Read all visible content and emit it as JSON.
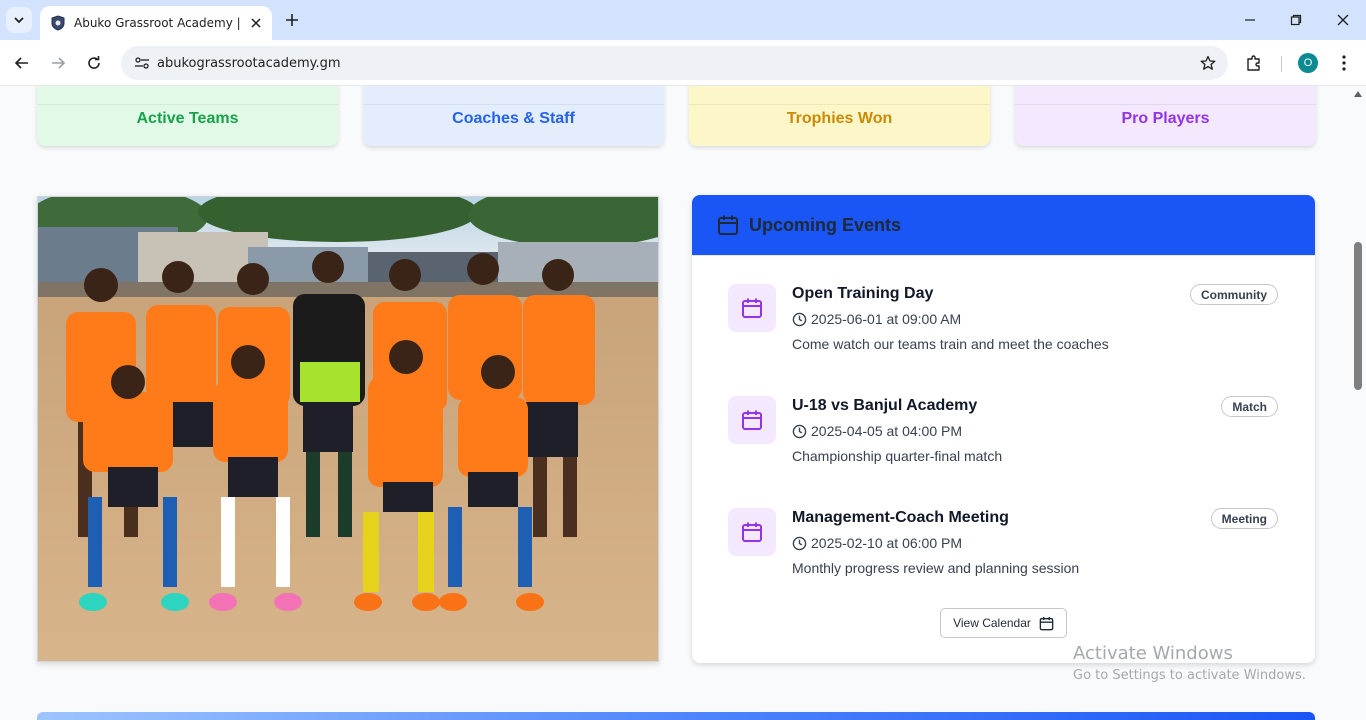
{
  "browser": {
    "tab_title": "Abuko Grassroot Academy | Football",
    "url": "abukograssrootacademy.gm",
    "profile_initial": "O",
    "icons": [
      "tab-list-icon",
      "shield-favicon-icon",
      "close-icon",
      "plus-icon",
      "minimize-icon",
      "restore-icon",
      "close-window-icon",
      "back-arrow-icon",
      "forward-arrow-icon",
      "reload-icon",
      "site-settings-icon",
      "bookmark-star-icon",
      "extensions-icon",
      "kebab-menu-icon"
    ]
  },
  "stats": [
    {
      "label": "Active Teams",
      "color": "#16a34a",
      "bg": "#e3f9e8"
    },
    {
      "label": "Coaches & Staff",
      "color": "#2563eb",
      "bg": "#e3edfb"
    },
    {
      "label": "Trophies Won",
      "color": "#ca8a04",
      "bg": "#fdf6c9"
    },
    {
      "label": "Pro Players",
      "color": "#9333ea",
      "bg": "#f3e8fd"
    }
  ],
  "events_panel": {
    "title": "Upcoming Events",
    "header_color": "#1a56f5",
    "items": [
      {
        "title": "Open Training Day",
        "time": "2025-06-01 at 09:00 AM",
        "description": "Come watch our teams train and meet the coaches",
        "badge": "Community"
      },
      {
        "title": "U-18 vs Banjul Academy",
        "time": "2025-04-05 at 04:00 PM",
        "description": "Championship quarter-final match",
        "badge": "Match"
      },
      {
        "title": "Management-Coach Meeting",
        "time": "2025-02-10 at 06:00 PM",
        "description": "Monthly progress review and planning session",
        "badge": "Meeting"
      }
    ],
    "button_label": "View Calendar"
  },
  "watermark": {
    "line1": "Activate Windows",
    "line2": "Go to Settings to activate Windows."
  }
}
